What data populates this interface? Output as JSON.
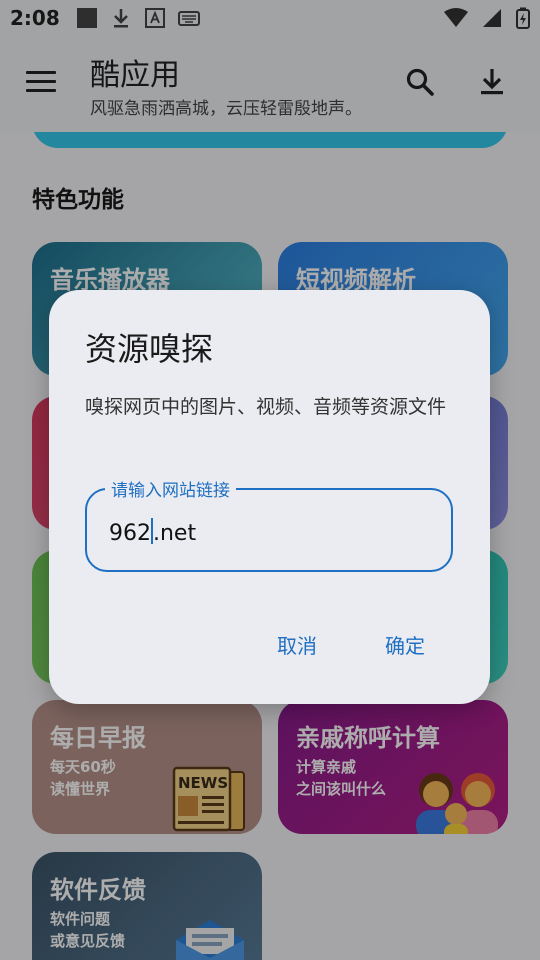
{
  "status": {
    "time": "2:08"
  },
  "appbar": {
    "title": "酷应用",
    "subtitle": "风驱急雨洒高城，云压轻雷殷地声。"
  },
  "section": {
    "title": "特色功能"
  },
  "cards": {
    "music": {
      "title": "音乐播放器"
    },
    "video": {
      "title": "短视频解析"
    },
    "news": {
      "title": "每日早报",
      "desc1": "每天60秒",
      "desc2": "读懂世界",
      "icon_text": "NEWS"
    },
    "kinship": {
      "title": "亲戚称呼计算",
      "desc1": "计算亲戚",
      "desc2": "之间该叫什么"
    },
    "feedback": {
      "title": "软件反馈",
      "desc1": "软件问题",
      "desc2": "或意见反馈"
    }
  },
  "dialog": {
    "title": "资源嗅探",
    "message": "嗅探网页中的图片、视频、音频等资源文件",
    "field_label": "请输入网站链接",
    "value_before": "962",
    "value_after": ".net",
    "cancel": "取消",
    "ok": "确定"
  },
  "colors": {
    "accent": "#1f6fc2",
    "banner": "#35c7ec"
  }
}
